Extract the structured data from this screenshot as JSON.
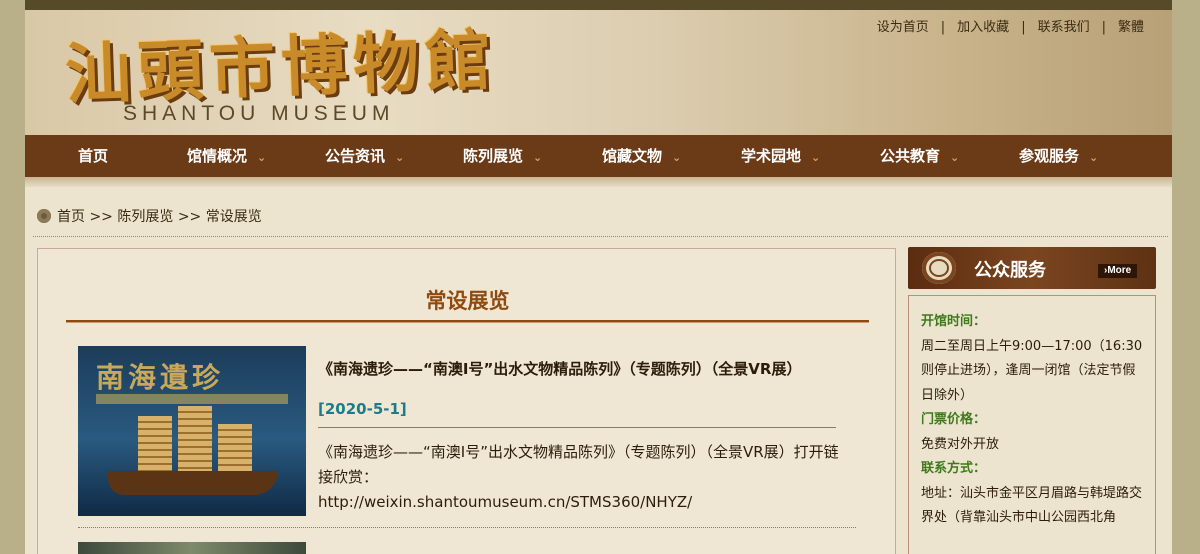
{
  "header": {
    "logo_cn": "汕頭市博物館",
    "logo_en": "SHANTOU MUSEUM",
    "links": [
      "设为首页",
      "加入收藏",
      "联系我们",
      "繁體"
    ],
    "separator": "|"
  },
  "nav": {
    "items": [
      {
        "label": "首页",
        "has_menu": false
      },
      {
        "label": "馆情概况",
        "has_menu": true
      },
      {
        "label": "公告资讯",
        "has_menu": true
      },
      {
        "label": "陈列展览",
        "has_menu": true
      },
      {
        "label": "馆藏文物",
        "has_menu": true
      },
      {
        "label": "学术园地",
        "has_menu": true
      },
      {
        "label": "公共教育",
        "has_menu": true
      },
      {
        "label": "参观服务",
        "has_menu": true
      }
    ],
    "chevron": "⌄"
  },
  "breadcrumb": {
    "home": "首页",
    "sep": ">>",
    "level1": "陈列展览",
    "current": "常设展览"
  },
  "main": {
    "title": "常设展览",
    "items": [
      {
        "title": "《南海遗珍——“南澳Ⅰ号”出水文物精品陈列》（专题陈列）（全景VR展）",
        "date": "[2020-5-1]",
        "image_title": "南海遺珍",
        "desc_line1": "《南海遗珍——“南澳Ⅰ号”出水文物精品陈列》（专题陈列）（全景VR展）打开链接欣赏：",
        "desc_url": "http://weixin.shantoumuseum.cn/STMS360/NHYZ/"
      }
    ]
  },
  "sidebar": {
    "title": "公众服务",
    "more": "More",
    "open_label": "开馆时间：",
    "open_text": "周二至周日上午9:00—17:00（16:30则停止进场），逢周一闭馆（法定节假日除外）",
    "ticket_label": "门票价格：",
    "ticket_text": "免费对外开放",
    "contact_label": "联系方式：",
    "contact_text": "地址：汕头市金平区月眉路与韩堤路交界处（背靠汕头市中山公园西北角"
  },
  "colors": {
    "nav_bg": "#6b3a17",
    "title_color": "#8e4a10",
    "date_color": "#1c7d8a",
    "label_green": "#3e7a1a"
  }
}
